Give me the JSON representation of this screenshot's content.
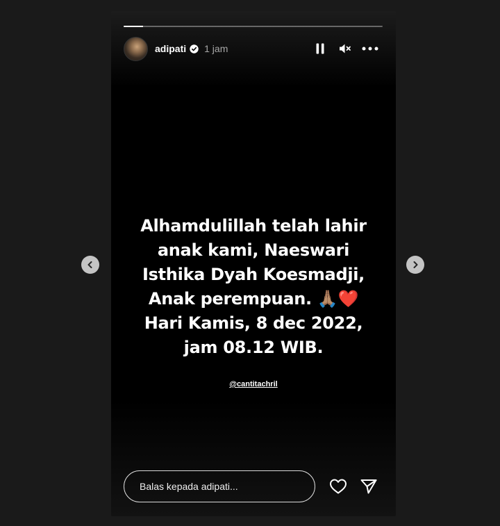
{
  "story": {
    "progress_fraction": 0.075,
    "user": {
      "username": "adipati",
      "verified": true,
      "time": "1 jam"
    },
    "controls": {
      "pause_icon": "pause-icon",
      "mute_icon": "muted-speaker-icon",
      "more_icon": "more-options-icon"
    },
    "text_lines": [
      "Alhamdulillah telah lahir",
      "anak kami, Naeswari",
      "Isthika Dyah Koesmadji,",
      "Anak perempuan. 🙏🏽❤️",
      "Hari Kamis, 8 dec 2022,",
      "jam 08.12 WIB."
    ],
    "mention": "@cantitachril"
  },
  "reply": {
    "placeholder": "Balas kepada adipati...",
    "like_icon": "heart-icon",
    "share_icon": "send-icon"
  },
  "navigation": {
    "prev_icon": "chevron-left-icon",
    "next_icon": "chevron-right-icon"
  },
  "colors": {
    "page_background": "#1a1a1a",
    "story_background": "#000000",
    "text": "#ffffff",
    "muted_text": "#a8a8a8",
    "nav_button": "#c4c4c4"
  }
}
